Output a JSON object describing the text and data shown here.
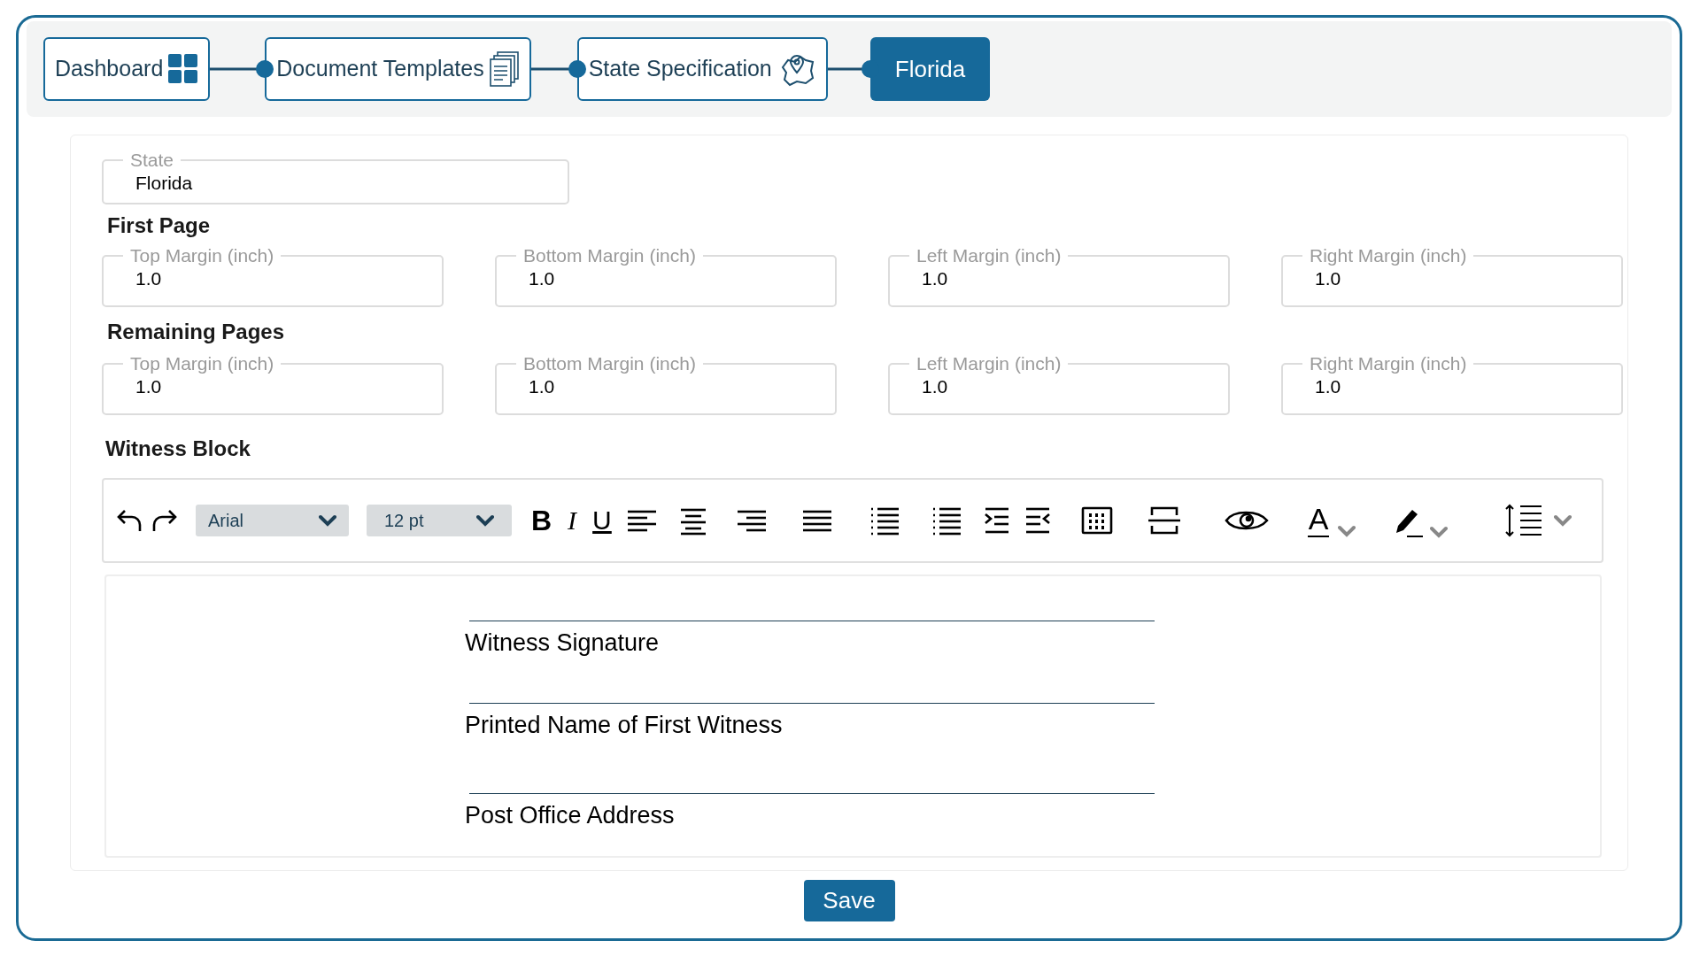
{
  "breadcrumbs": [
    {
      "label": "Dashboard",
      "selected": false
    },
    {
      "label": "Document Templates",
      "selected": false
    },
    {
      "label": "State Specification",
      "selected": false
    },
    {
      "label": "Florida",
      "selected": true
    }
  ],
  "state_field": {
    "label": "State",
    "value": "Florida"
  },
  "sections": [
    {
      "title": "First Page",
      "fields": [
        {
          "label": "Top Margin (inch)",
          "value": "1.0"
        },
        {
          "label": "Bottom Margin (inch)",
          "value": "1.0"
        },
        {
          "label": "Left Margin (inch)",
          "value": "1.0"
        },
        {
          "label": "Right Margin (inch)",
          "value": "1.0"
        }
      ]
    },
    {
      "title": "Remaining Pages",
      "fields": [
        {
          "label": "Top Margin (inch)",
          "value": "1.0"
        },
        {
          "label": "Bottom Margin (inch)",
          "value": "1.0"
        },
        {
          "label": "Left Margin (inch)",
          "value": "1.0"
        },
        {
          "label": "Right Margin (inch)",
          "value": "1.0"
        }
      ]
    }
  ],
  "witness_block": {
    "title": "Witness Block",
    "toolbar": {
      "font": "Arial",
      "size": "12 pt",
      "format_buttons": [
        "B",
        "I",
        "U"
      ],
      "text_color": "A"
    },
    "signature_lines": [
      "Witness Signature",
      "Printed Name of First Witness",
      "Post Office Address"
    ]
  },
  "save_button": "Save"
}
